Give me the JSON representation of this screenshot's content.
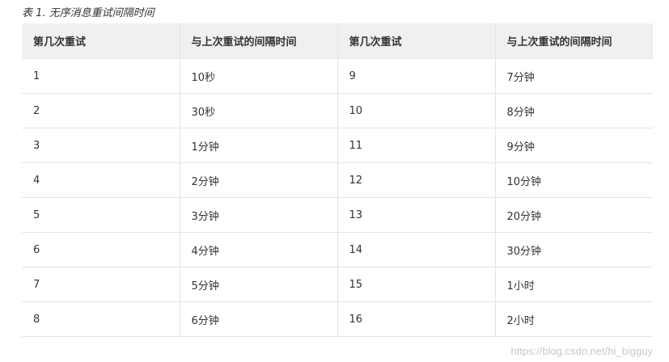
{
  "caption": "表 1. 无序消息重试间隔时间",
  "table": {
    "headers": [
      "第几次重试",
      "与上次重试的间隔时间",
      "第几次重试",
      "与上次重试的间隔时间"
    ],
    "rows": [
      [
        "1",
        "10秒",
        "9",
        "7分钟"
      ],
      [
        "2",
        "30秒",
        "10",
        "8分钟"
      ],
      [
        "3",
        "1分钟",
        "11",
        "9分钟"
      ],
      [
        "4",
        "2分钟",
        "12",
        "10分钟"
      ],
      [
        "5",
        "3分钟",
        "13",
        "20分钟"
      ],
      [
        "6",
        "4分钟",
        "14",
        "30分钟"
      ],
      [
        "7",
        "5分钟",
        "15",
        "1小时"
      ],
      [
        "8",
        "6分钟",
        "16",
        "2小时"
      ]
    ]
  },
  "watermark": "https://blog.csdn.net/hi_bigguy",
  "colors": {
    "header_bg": "#f0f0f0",
    "border": "#e4e4e4",
    "text": "#333333",
    "watermark": "#c8c8c8"
  }
}
